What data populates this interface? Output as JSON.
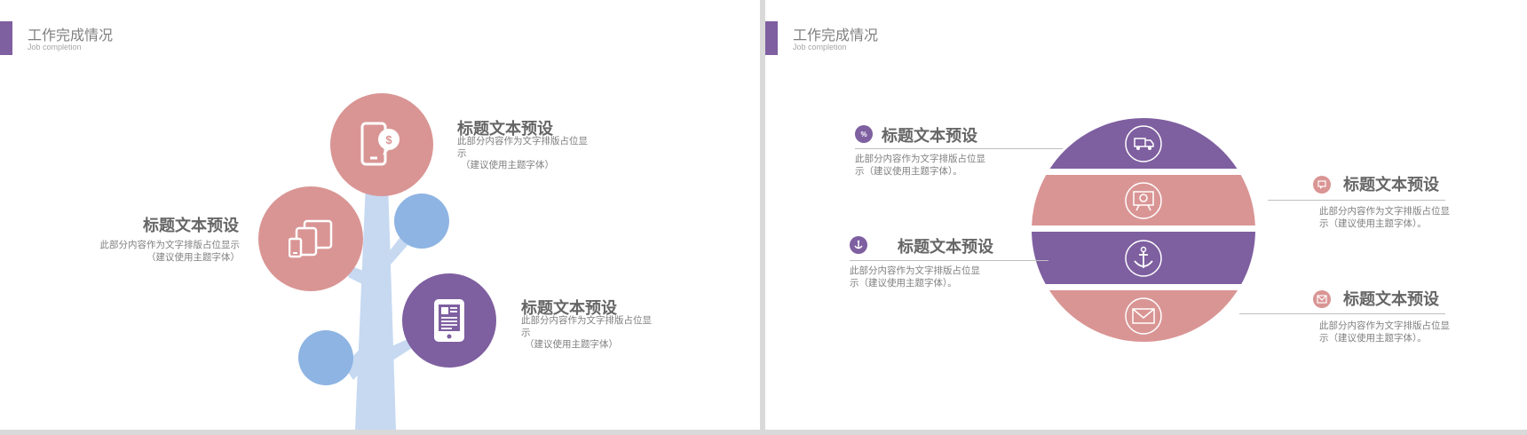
{
  "slide_left": {
    "title": "工作完成情况",
    "subtitle": "Job completion",
    "items": [
      {
        "heading": "标题文本预设",
        "body": "此部分内容作为文字排版占位显示",
        "note": "（建议使用主题字体）",
        "icon": "mobile-payment-icon"
      },
      {
        "heading": "标题文本预设",
        "body": "此部分内容作为文字排版占位显示",
        "note": "（建议使用主题字体）",
        "icon": "devices-icon"
      },
      {
        "heading": "标题文本预设",
        "body": "此部分内容作为文字排版占位显示",
        "note": "（建议使用主题字体）",
        "icon": "tablet-news-icon"
      }
    ]
  },
  "slide_right": {
    "title": "工作完成情况",
    "subtitle": "Job completion",
    "items": [
      {
        "heading": "标题文本预设",
        "body": "此部分内容作为文字排版占位显示（建议使用主题字体）。",
        "icon": "percent-tag-icon"
      },
      {
        "heading": "标题文本预设",
        "body": "此部分内容作为文字排版占位显示（建议使用主题字体）。",
        "icon": "anchor-icon"
      },
      {
        "heading": "标题文本预设",
        "body": "此部分内容作为文字排版占位显示（建议使用主题字体）。",
        "icon": "chat-icon"
      },
      {
        "heading": "标题文本预设",
        "body": "此部分内容作为文字排版占位显示（建议使用主题字体）。",
        "icon": "mail-icon"
      }
    ],
    "band_icons": [
      "delivery-truck-icon",
      "presentation-board-icon",
      "anchor-icon",
      "envelope-icon"
    ]
  },
  "colors": {
    "purple": "#7e5fa0",
    "pink": "#d99594",
    "blue": "#8eb4e3",
    "trunk": "#c6d9f1",
    "text": "#7f7f7f",
    "heading": "#666666"
  }
}
